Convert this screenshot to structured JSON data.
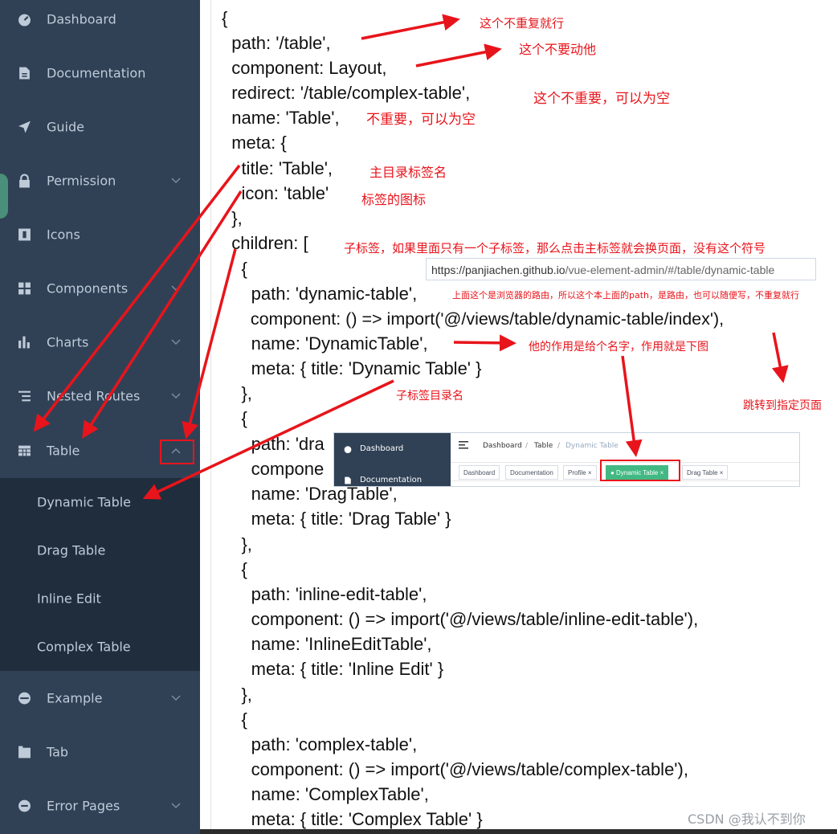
{
  "colors": {
    "sidebar_bg": "#304156",
    "submenu_bg": "#1f2d3d",
    "menu_text": "#bfcbd9",
    "annotation_red": "#e8141b",
    "active_tag": "#42b983"
  },
  "sidebar": {
    "items": [
      {
        "label": "Dashboard",
        "icon": "dashboard-icon"
      },
      {
        "label": "Documentation",
        "icon": "document-icon"
      },
      {
        "label": "Guide",
        "icon": "guide-icon"
      },
      {
        "label": "Permission",
        "icon": "lock-icon",
        "has_children": true
      },
      {
        "label": "Icons",
        "icon": "icons-icon"
      },
      {
        "label": "Components",
        "icon": "components-icon",
        "has_children": true
      },
      {
        "label": "Charts",
        "icon": "chart-icon",
        "has_children": true
      },
      {
        "label": "Nested Routes",
        "icon": "nested-icon",
        "has_children": true
      },
      {
        "label": "Table",
        "icon": "table-icon",
        "has_children": true,
        "expanded": true
      },
      {
        "label": "Example",
        "icon": "example-icon",
        "has_children": true
      },
      {
        "label": "Tab",
        "icon": "tab-icon"
      },
      {
        "label": "Error Pages",
        "icon": "error-icon",
        "has_children": true
      }
    ],
    "table_children": [
      "Dynamic Table",
      "Drag Table",
      "Inline Edit",
      "Complex Table"
    ]
  },
  "code_lines": [
    "{",
    "  path: '/table',",
    "  component: Layout,",
    "  redirect: '/table/complex-table',",
    "  name: 'Table',",
    "  meta: {",
    "    title: 'Table',",
    "    icon: 'table'",
    "  },",
    "  children: [",
    "    {",
    "      path: 'dynamic-table',",
    "      component: () => import('@/views/table/dynamic-table/index'),",
    "      name: 'DynamicTable',",
    "      meta: { title: 'Dynamic Table' }",
    "    },",
    "    {",
    "      path: 'dra",
    "      compone",
    "      name: 'DragTable',",
    "      meta: { title: 'Drag Table' }",
    "    },",
    "    {",
    "      path: 'inline-edit-table',",
    "      component: () => import('@/views/table/inline-edit-table'),",
    "      name: 'InlineEditTable',",
    "      meta: { title: 'Inline Edit' }",
    "    },",
    "    {",
    "      path: 'complex-table',",
    "      component: () => import('@/views/table/complex-table'),",
    "      name: 'ComplexTable',",
    "      meta: { title: 'Complex Table' }"
  ],
  "annotations": {
    "path": "这个不重复就行",
    "component": "这个不要动他",
    "redirect": "这个不重要，可以为空",
    "name": "不重要，可以为空",
    "title": "主目录标签名",
    "icon": "标签的图标",
    "children": "子标签，如果里面只有一个子标签，那么点击主标签就会换页面，没有这个符号",
    "child_path": "上面这个是浏览器的路由，所以这个本上面的path，是路由，也可以随便写，不重复就行",
    "child_name": "他的作用是给个名字，作用就是下图",
    "child_title": "子标签目录名",
    "child_component": "跳转到指定页面"
  },
  "url_bar": {
    "host": "https://panjiachen.github.io",
    "path": "/vue-element-admin/#/table/dynamic-table"
  },
  "inset": {
    "sidebar": [
      "Dashboard",
      "Documentation"
    ],
    "breadcrumb": [
      "Dashboard",
      "/",
      "Table",
      "/",
      "Dynamic Table"
    ],
    "tags": [
      "Dashboard",
      "Documentation",
      "Profile ×",
      "● Dynamic Table ×",
      "Drag Table ×"
    ]
  },
  "watermark": "CSDN @我认不到你"
}
